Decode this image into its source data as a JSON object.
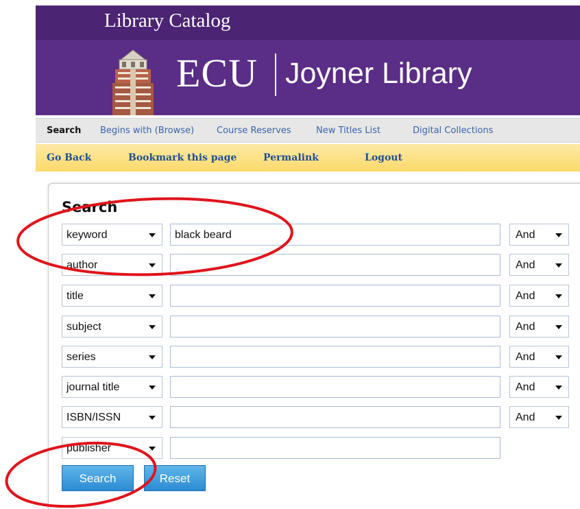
{
  "header": {
    "catalog_title": "Library Catalog",
    "logo_ecu": "ECU",
    "logo_library": "Joyner Library",
    "brand_color": "#5a2d86"
  },
  "nav_primary": [
    {
      "label": "Search",
      "active": true
    },
    {
      "label": "Begins with (Browse)"
    },
    {
      "label": "Course Reserves"
    },
    {
      "label": "New Titles List"
    },
    {
      "label": "Digital Collections"
    }
  ],
  "nav_secondary": [
    {
      "label": "Go Back"
    },
    {
      "label": "Bookmark this page"
    },
    {
      "label": "Permalink"
    },
    {
      "label": "Logout"
    }
  ],
  "search": {
    "heading": "Search",
    "rows": [
      {
        "field": "keyword",
        "value": "black beard",
        "operator": "And"
      },
      {
        "field": "author",
        "value": "",
        "operator": "And"
      },
      {
        "field": "title",
        "value": "",
        "operator": "And"
      },
      {
        "field": "subject",
        "value": "",
        "operator": "And"
      },
      {
        "field": "series",
        "value": "",
        "operator": "And"
      },
      {
        "field": "journal title",
        "value": "",
        "operator": "And"
      },
      {
        "field": "ISBN/ISSN",
        "value": "",
        "operator": "And"
      },
      {
        "field": "publisher",
        "value": ""
      }
    ],
    "search_button": "Search",
    "reset_button": "Reset"
  },
  "annotation_color": "#e0141b"
}
